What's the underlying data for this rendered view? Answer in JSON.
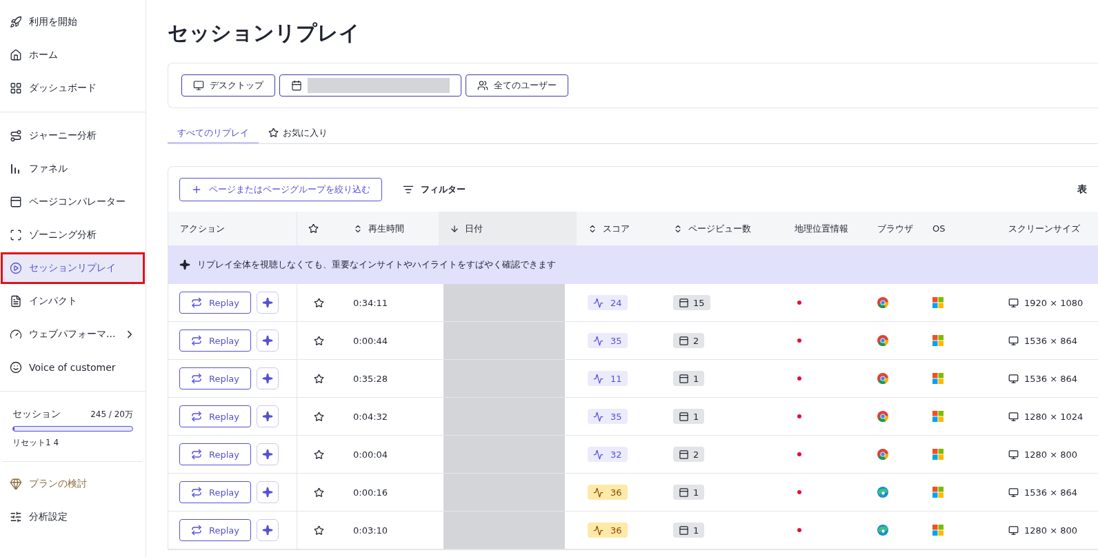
{
  "sidebar": {
    "groups": [
      {
        "items": [
          {
            "label": "利用を開始",
            "selected": false
          },
          {
            "label": "ホーム",
            "selected": false
          },
          {
            "label": "ダッシュボード",
            "selected": false
          }
        ]
      },
      {
        "items": [
          {
            "label": "ジャーニー分析",
            "selected": false
          },
          {
            "label": "ファネル",
            "selected": false
          },
          {
            "label": "ページコンパレーター",
            "selected": false
          },
          {
            "label": "ゾーニング分析",
            "selected": false
          },
          {
            "label": "セッションリプレイ",
            "selected": true
          },
          {
            "label": "インパクト",
            "selected": false
          },
          {
            "label": "ウェブパフォーマ...",
            "selected": false,
            "has_submenu": true
          },
          {
            "label": "Voice of customer",
            "selected": false
          }
        ]
      }
    ],
    "usage": {
      "label": "セッション",
      "count": "245 / 20万",
      "level": 0.01,
      "reset": "リセット1 4"
    },
    "footer_items": [
      {
        "label": "プランの検討",
        "kind": "upgrade"
      },
      {
        "label": "分析設定",
        "kind": "normal"
      }
    ]
  },
  "page_title": "セッションリプレイ",
  "filters": [
    {
      "label": "デスクトップ",
      "kind": "text"
    },
    {
      "kind": "redacted"
    },
    {
      "label": "全てのユーザー",
      "kind": "text"
    }
  ],
  "tabs": [
    {
      "label": "すべてのリプレイ",
      "selected": true
    },
    {
      "label": "お気に入り",
      "selected": false
    }
  ],
  "toolbar": {
    "add_button": "ページまたはページグループを絞り込む",
    "filter_button": "フィルター",
    "column_right": "表"
  },
  "table": {
    "columns": [
      {
        "label": "アクション",
        "kind": "plain"
      },
      {
        "kind": "star"
      },
      {
        "label": "再生時間",
        "kind": "sortable"
      },
      {
        "label": "日付",
        "kind": "sorted"
      },
      {
        "label": "スコア",
        "kind": "sortable"
      },
      {
        "label": "ページビュー数",
        "kind": "sortable"
      },
      {
        "label": "地理位置情報",
        "kind": "plain"
      },
      {
        "label": "ブラウザ",
        "kind": "plain"
      },
      {
        "label": "OS",
        "kind": "plain"
      },
      {
        "label": "スクリーンサイズ",
        "kind": "plain"
      }
    ],
    "banner": "リプレイ全体を視聴しなくても、重要なインサイトやハイライトをすばやく確認できます",
    "rows": [
      {
        "action": "Replay",
        "duration": "0:34:11",
        "score": {
          "value": "24",
          "kind": "normal"
        },
        "pageviews": "15",
        "browser": {
          "kind": "chrome"
        },
        "os": {
          "kind": "windows"
        },
        "screen": "1920 × 1080"
      },
      {
        "action": "Replay",
        "duration": "0:00:44",
        "score": {
          "value": "35",
          "kind": "normal"
        },
        "pageviews": "2",
        "browser": {
          "kind": "chrome"
        },
        "os": {
          "kind": "windows"
        },
        "screen": "1536 × 864"
      },
      {
        "action": "Replay",
        "duration": "0:35:28",
        "score": {
          "value": "11",
          "kind": "normal"
        },
        "pageviews": "1",
        "browser": {
          "kind": "chrome"
        },
        "os": {
          "kind": "windows"
        },
        "screen": "1536 × 864"
      },
      {
        "action": "Replay",
        "duration": "0:04:32",
        "score": {
          "value": "35",
          "kind": "normal"
        },
        "pageviews": "1",
        "browser": {
          "kind": "chrome"
        },
        "os": {
          "kind": "windows"
        },
        "screen": "1280 × 1024"
      },
      {
        "action": "Replay",
        "duration": "0:00:04",
        "score": {
          "value": "32",
          "kind": "normal"
        },
        "pageviews": "2",
        "browser": {
          "kind": "chrome"
        },
        "os": {
          "kind": "windows"
        },
        "screen": "1280 × 800"
      },
      {
        "action": "Replay",
        "duration": "0:00:16",
        "score": {
          "value": "36",
          "kind": "warning"
        },
        "pageviews": "1",
        "browser": {
          "kind": "edge"
        },
        "os": {
          "kind": "windows"
        },
        "screen": "1536 × 864"
      },
      {
        "action": "Replay",
        "duration": "0:03:10",
        "score": {
          "value": "36",
          "kind": "warning"
        },
        "pageviews": "1",
        "browser": {
          "kind": "edge"
        },
        "os": {
          "kind": "windows"
        },
        "screen": "1280 × 800"
      }
    ]
  }
}
